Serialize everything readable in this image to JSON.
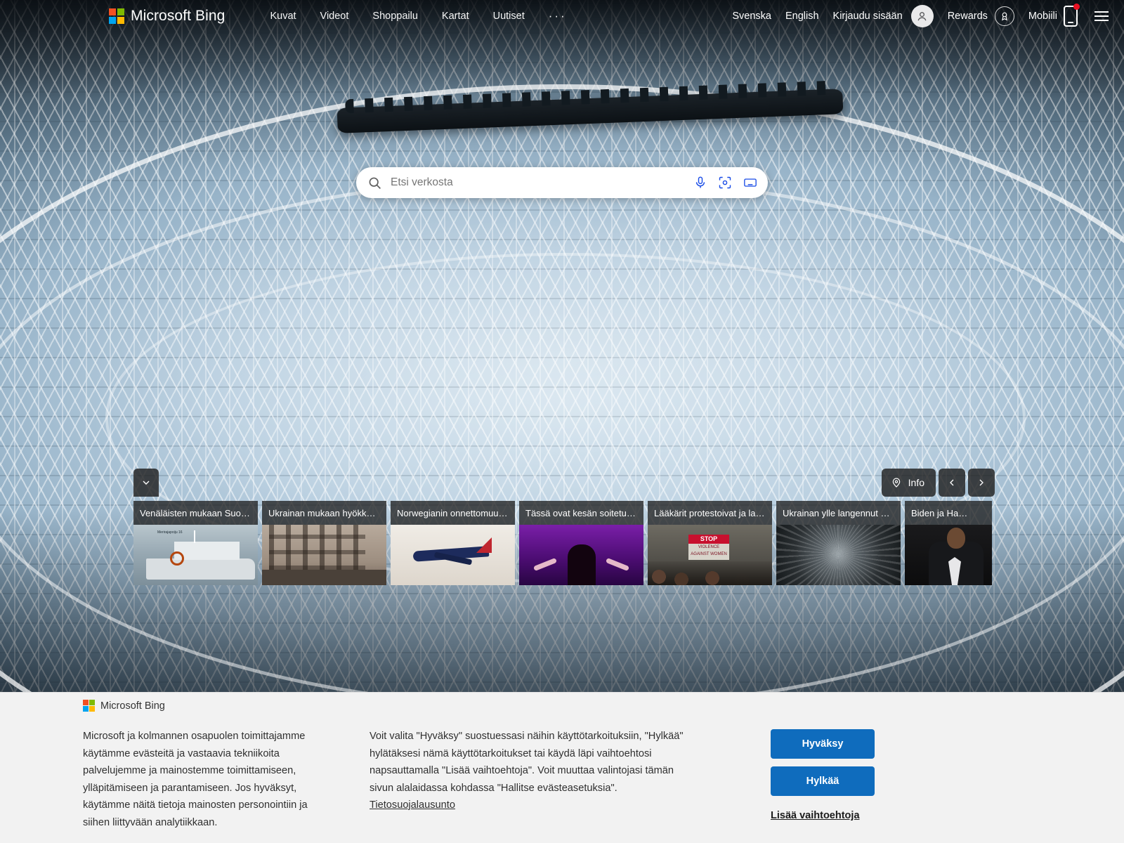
{
  "header": {
    "brand": "Microsoft Bing",
    "nav": [
      {
        "label": "Kuvat",
        "name": "nav-images"
      },
      {
        "label": "Videot",
        "name": "nav-videos"
      },
      {
        "label": "Shoppailu",
        "name": "nav-shopping"
      },
      {
        "label": "Kartat",
        "name": "nav-maps"
      },
      {
        "label": "Uutiset",
        "name": "nav-news"
      }
    ],
    "more": "···",
    "right": {
      "lang_sv": "Svenska",
      "lang_en": "English",
      "signin": "Kirjaudu sisään",
      "rewards": "Rewards",
      "mobile": "Mobiili"
    }
  },
  "search": {
    "placeholder": "Etsi verkosta",
    "value": ""
  },
  "carousel": {
    "info_label": "Info",
    "cards": [
      {
        "title": "Venäläisten mukaan Suo…",
        "art": "art-ship",
        "caption": "Merirajapoiju 16"
      },
      {
        "title": "Ukrainan mukaan hyökkä…",
        "art": "art-rubble"
      },
      {
        "title": "Norwegianin onnettomuus…",
        "art": "art-plane"
      },
      {
        "title": "Tässä ovat kesän soitetui…",
        "art": "art-stage"
      },
      {
        "title": "Lääkärit protestoivat ja lak…",
        "art": "art-protest",
        "sign_top": "STOP",
        "sign_sub": "VIOLENCE",
        "sign_sub2": "AGAINST WOMEN"
      },
      {
        "title": "Ukrainan ylle langennut e…",
        "art": "art-crater"
      },
      {
        "title": "Biden ja Ha…",
        "art": "art-speaker"
      }
    ]
  },
  "consent": {
    "brand": "Microsoft Bing",
    "paragraph_left": "Microsoft ja kolmannen osapuolen toimittajamme käytämme evästeitä ja vastaavia tekniikoita palvelujemme ja mainostemme toimittamiseen, ylläpitämiseen ja parantamiseen. Jos hyväksyt, käytämme näitä tietoja mainosten personointiin ja siihen liittyvään analytiikkaan.",
    "paragraph_right": "Voit valita \"Hyväksy\" suostuessasi näihin käyttötarkoituksiin, \"Hylkää\" hylätäksesi nämä käyttötarkoitukset tai käydä läpi vaihtoehtosi napsauttamalla \"Lisää vaihtoehtoja\". Voit muuttaa valintojasi tämän sivun alalaidassa kohdassa \"Hallitse evästeasetuksia\". ",
    "privacy_link": "Tietosuojalausunto",
    "accept": "Hyväksy",
    "reject": "Hylkää",
    "more_options": "Lisää vaihtoehtoja"
  },
  "colors": {
    "accent_blue": "#0f6cbd",
    "bing_icon_blue": "#174ae6",
    "consent_bg": "#f2f2f2",
    "notification_red": "#e81123"
  }
}
